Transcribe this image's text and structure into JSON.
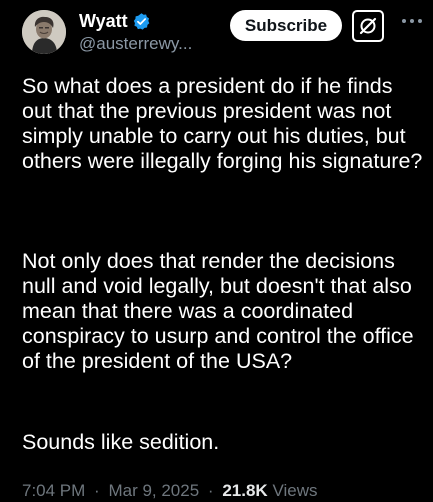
{
  "author": {
    "display_name": "Wyatt",
    "handle": "@austerrewy..."
  },
  "header": {
    "subscribe_label": "Subscribe"
  },
  "tweet": {
    "paragraphs": [
      "So what does a president do if he finds out that the previous president was not simply unable to carry out his duties, but others were illegally forging his signature?",
      "Not only does that render the decisions null and void legally, but doesn't that also mean that there was a coordinated conspiracy to usurp and control the office of the president of the USA?",
      "Sounds like sedition."
    ]
  },
  "meta": {
    "time": "7:04 PM",
    "separator": "·",
    "date": "Mar 9, 2025",
    "views_count": "21.8K",
    "views_label": "Views"
  },
  "icons": {
    "verified": "verified-badge-icon",
    "grok": "grok-icon",
    "more": "more-options-icon"
  },
  "colors": {
    "background": "#000000",
    "text": "#ffffff",
    "secondary_text": "#8b98a5",
    "verified_blue": "#1d9bf0"
  }
}
